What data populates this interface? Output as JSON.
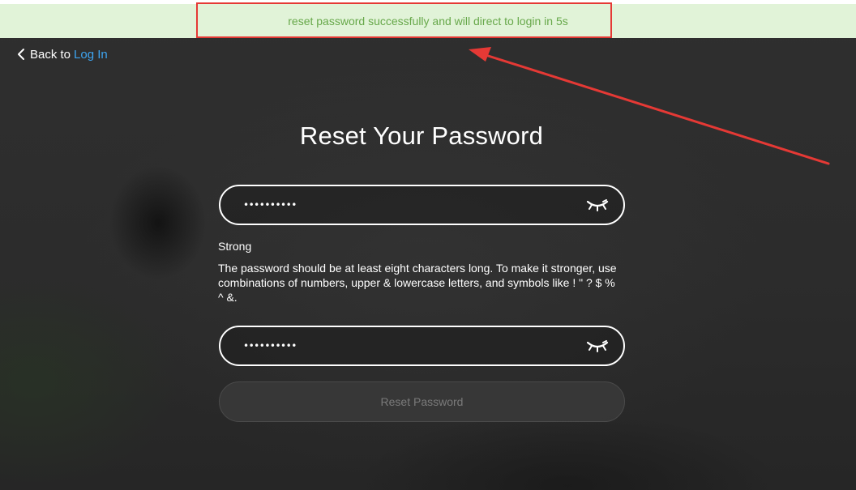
{
  "toast": {
    "message": "reset password successfully and will direct to login in 5s"
  },
  "nav": {
    "back_prefix": "Back to",
    "back_link": "Log In"
  },
  "form": {
    "title": "Reset Your Password",
    "password": {
      "masked_value": "••••••••••",
      "icon": "eye-closed-icon"
    },
    "strength_label": "Strong",
    "hint": "The password should be at least eight characters long. To make it stronger, use combinations of numbers, upper & lowercase letters, and symbols like ! \" ? $ % ^ &.",
    "confirm_password": {
      "masked_value": "••••••••••",
      "icon": "eye-closed-icon"
    },
    "submit_label": "Reset Password"
  },
  "colors": {
    "toast_bg": "#e1f3d8",
    "toast_text": "#67a84a",
    "annotation_red": "#e53935",
    "link_blue": "#3da4f0",
    "button_disabled_text": "#7a7a7a"
  }
}
